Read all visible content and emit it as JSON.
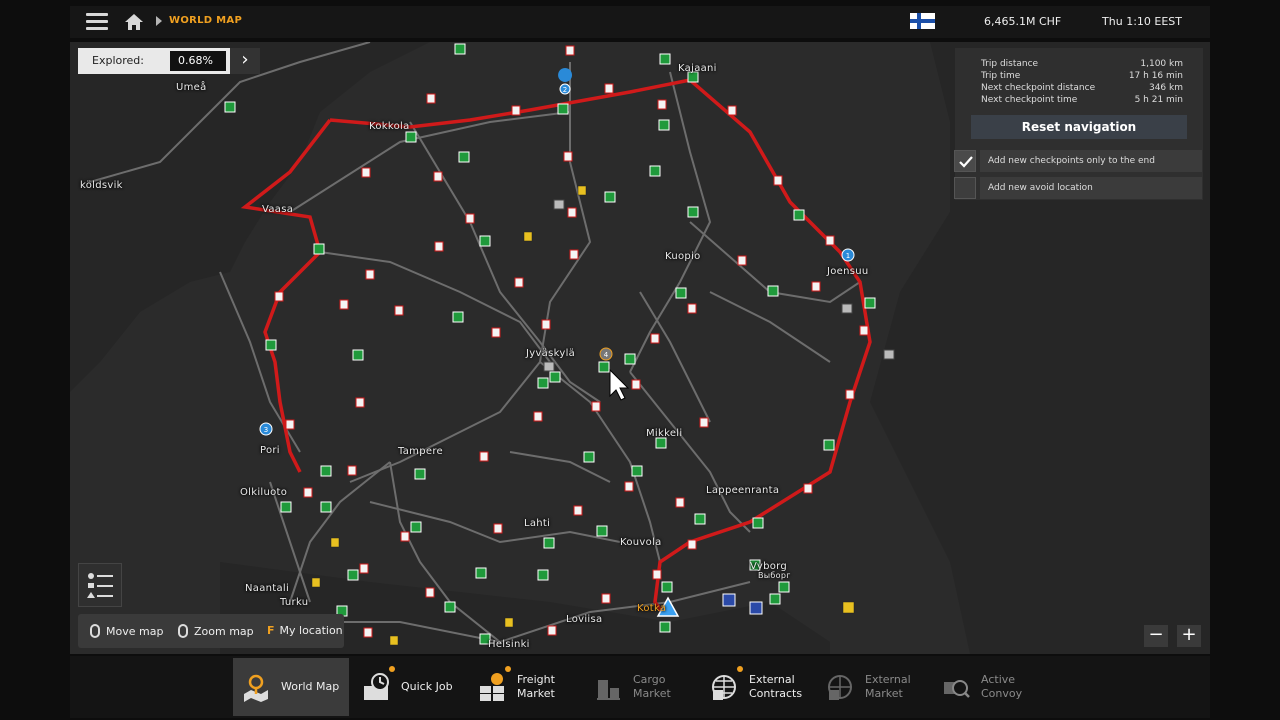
{
  "header": {
    "breadcrumb": "WORLD MAP",
    "money": "6,465.1M  CHF",
    "clock": "Thu 1:10 EEST"
  },
  "explored": {
    "label": "Explored:",
    "value": "0.68%"
  },
  "trip": {
    "rows": [
      {
        "label": "Trip distance",
        "value": "1,100 km"
      },
      {
        "label": "Trip time",
        "value": "17 h 16 min"
      },
      {
        "label": "Next checkpoint distance",
        "value": "346 km"
      },
      {
        "label": "Next checkpoint time",
        "value": "5 h 21 min"
      }
    ],
    "reset_label": "Reset navigation",
    "options": [
      {
        "label": "Add new checkpoints only to the end",
        "checked": true
      },
      {
        "label": "Add new avoid location",
        "checked": false
      }
    ]
  },
  "cities": [
    "Umeå",
    "Kokkola",
    "Kajaani",
    "Vaasa",
    "köldsvik",
    "Kuopio",
    "Joensuu",
    "Jyväskylä",
    "Pori",
    "Tampere",
    "Mikkeli",
    "Lappeenranta",
    "Olkiluoto",
    "Lahti",
    "Kouvola",
    "Naantali",
    "Turku",
    "Vyborg",
    "Выборг",
    "Kotka",
    "Loviisa",
    "Helsinki"
  ],
  "checkpoints": [
    "1",
    "2",
    "3",
    "4"
  ],
  "controls": {
    "move": "Move map",
    "zoom": "Zoom map",
    "location_key": "F",
    "location": "My location",
    "zoom_out": "−",
    "zoom_in": "+"
  },
  "nav": {
    "tabs": [
      {
        "label": "World Map",
        "active": true,
        "enabled": true,
        "badge": false
      },
      {
        "label": "Quick Job",
        "active": false,
        "enabled": true,
        "badge": true
      },
      {
        "label": "Freight Market",
        "active": false,
        "enabled": true,
        "badge": true
      },
      {
        "label": "Cargo Market",
        "active": false,
        "enabled": false,
        "badge": false
      },
      {
        "label": "External Contracts",
        "active": false,
        "enabled": true,
        "badge": true
      },
      {
        "label": "External Market",
        "active": false,
        "enabled": false,
        "badge": false
      },
      {
        "label": "Active Convoy",
        "active": false,
        "enabled": false,
        "badge": false
      }
    ]
  },
  "colors": {
    "accent": "#f0a020",
    "route": "#d01a1a",
    "depot": "#1f9a3b",
    "waypoint": "#2a8ad8"
  },
  "icons": [
    "menu-icon",
    "home-icon",
    "finland-flag-icon",
    "chevron-right-icon",
    "checkmark-icon",
    "legend-icon",
    "mouse-icon",
    "truck-marker-icon",
    "cursor-icon"
  ]
}
